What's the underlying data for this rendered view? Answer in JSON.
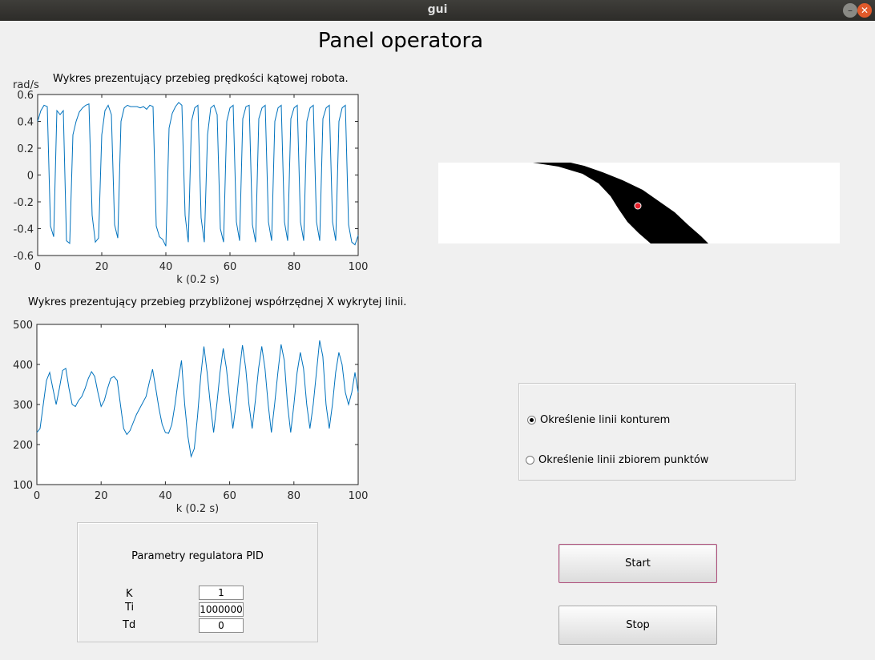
{
  "window": {
    "title": "gui"
  },
  "page": {
    "heading": "Panel operatora"
  },
  "chart_data": [
    {
      "type": "line",
      "title": "Wykres prezentujący przebieg prędkości kątowej robota.",
      "xlabel": "k (0.2 s)",
      "ylabel": "rad/s",
      "xlim": [
        0,
        100
      ],
      "ylim": [
        -0.6,
        0.6
      ],
      "xticks": [
        0,
        20,
        40,
        60,
        80,
        100
      ],
      "yticks": [
        0.6,
        0.4,
        0.2,
        0,
        -0.2,
        -0.4,
        -0.6
      ],
      "ytick_labels": [
        "0.6",
        "0.4",
        "0.2",
        "0",
        "-0.2",
        "-0.4",
        "-0.6"
      ],
      "grid": false,
      "color": "#0072bd",
      "x": [
        0,
        1,
        2,
        3,
        4,
        5,
        6,
        7,
        8,
        9,
        10,
        11,
        12,
        13,
        14,
        15,
        16,
        17,
        18,
        19,
        20,
        21,
        22,
        23,
        24,
        25,
        26,
        27,
        28,
        29,
        30,
        31,
        32,
        33,
        34,
        35,
        36,
        37,
        38,
        39,
        40,
        41,
        42,
        43,
        44,
        45,
        46,
        47,
        48,
        49,
        50,
        51,
        52,
        53,
        54,
        55,
        56,
        57,
        58,
        59,
        60,
        61,
        62,
        63,
        64,
        65,
        66,
        67,
        68,
        69,
        70,
        71,
        72,
        73,
        74,
        75,
        76,
        77,
        78,
        79,
        80,
        81,
        82,
        83,
        84,
        85,
        86,
        87,
        88,
        89,
        90,
        91,
        92,
        93,
        94,
        95,
        96,
        97,
        98,
        99,
        100
      ],
      "y": [
        0.4,
        0.48,
        0.52,
        0.51,
        -0.38,
        -0.46,
        0.48,
        0.45,
        0.48,
        -0.49,
        -0.51,
        0.3,
        0.4,
        0.47,
        0.5,
        0.52,
        0.53,
        -0.3,
        -0.5,
        -0.47,
        0.3,
        0.48,
        0.52,
        0.45,
        -0.37,
        -0.47,
        0.4,
        0.5,
        0.52,
        0.51,
        0.51,
        0.51,
        0.5,
        0.51,
        0.49,
        0.52,
        0.51,
        -0.38,
        -0.46,
        -0.48,
        -0.53,
        0.35,
        0.46,
        0.51,
        0.54,
        0.52,
        -0.3,
        -0.5,
        0.4,
        0.5,
        0.52,
        -0.32,
        -0.5,
        0.3,
        0.5,
        0.52,
        0.45,
        -0.4,
        -0.5,
        0.4,
        0.5,
        0.52,
        -0.35,
        -0.49,
        0.42,
        0.51,
        0.52,
        -0.37,
        -0.5,
        0.42,
        0.5,
        0.52,
        -0.35,
        -0.49,
        0.4,
        0.5,
        0.52,
        -0.35,
        -0.49,
        0.42,
        0.5,
        0.52,
        -0.35,
        -0.49,
        0.4,
        0.5,
        0.52,
        -0.35,
        -0.49,
        0.42,
        0.5,
        0.52,
        -0.35,
        -0.49,
        0.4,
        0.5,
        0.52,
        -0.37,
        -0.5,
        -0.52,
        -0.45
      ]
    },
    {
      "type": "line",
      "title": "Wykres prezentujący przebieg przybliżonej współrzędnej X wykrytej linii.",
      "xlabel": "k (0.2 s)",
      "ylabel": "",
      "xlim": [
        0,
        100
      ],
      "ylim": [
        100,
        500
      ],
      "xticks": [
        0,
        20,
        40,
        60,
        80,
        100
      ],
      "yticks": [
        500,
        400,
        300,
        200,
        100
      ],
      "ytick_labels": [
        "500",
        "400",
        "300",
        "200",
        "100"
      ],
      "grid": false,
      "color": "#0072bd",
      "x": [
        0,
        1,
        2,
        3,
        4,
        5,
        6,
        7,
        8,
        9,
        10,
        11,
        12,
        13,
        14,
        15,
        16,
        17,
        18,
        19,
        20,
        21,
        22,
        23,
        24,
        25,
        26,
        27,
        28,
        29,
        30,
        31,
        32,
        33,
        34,
        35,
        36,
        37,
        38,
        39,
        40,
        41,
        42,
        43,
        44,
        45,
        46,
        47,
        48,
        49,
        50,
        51,
        52,
        53,
        54,
        55,
        56,
        57,
        58,
        59,
        60,
        61,
        62,
        63,
        64,
        65,
        66,
        67,
        68,
        69,
        70,
        71,
        72,
        73,
        74,
        75,
        76,
        77,
        78,
        79,
        80,
        81,
        82,
        83,
        84,
        85,
        86,
        87,
        88,
        89,
        90,
        91,
        92,
        93,
        94,
        95,
        96,
        97,
        98,
        99,
        100
      ],
      "y": [
        230,
        240,
        300,
        360,
        380,
        340,
        300,
        340,
        385,
        390,
        340,
        300,
        295,
        310,
        320,
        340,
        365,
        382,
        370,
        330,
        295,
        310,
        340,
        365,
        370,
        360,
        300,
        240,
        225,
        235,
        255,
        275,
        290,
        305,
        320,
        355,
        388,
        340,
        290,
        250,
        230,
        228,
        250,
        300,
        360,
        410,
        300,
        220,
        170,
        190,
        270,
        370,
        445,
        380,
        300,
        230,
        300,
        380,
        440,
        390,
        310,
        240,
        300,
        380,
        448,
        390,
        300,
        240,
        310,
        390,
        445,
        390,
        300,
        230,
        300,
        380,
        450,
        410,
        300,
        230,
        300,
        380,
        430,
        390,
        300,
        240,
        300,
        380,
        460,
        420,
        300,
        240,
        300,
        380,
        430,
        400,
        330,
        300,
        330,
        380,
        330
      ]
    }
  ],
  "camera": {
    "colors": {
      "background": "#ffffff",
      "line": "#000000",
      "marker": "#e6202b"
    },
    "marker_label": "centroid-marker"
  },
  "radio_group": {
    "options": [
      {
        "label": "Określenie linii konturem",
        "selected": true
      },
      {
        "label": "Określenie linii zbiorem punktów",
        "selected": false
      }
    ]
  },
  "pid": {
    "title": "Parametry regulatora PID",
    "params": [
      {
        "label": "K",
        "value": "1"
      },
      {
        "label": "Ti",
        "value": "1000000"
      },
      {
        "label": "Td",
        "value": "0"
      }
    ]
  },
  "buttons": {
    "start_label": "Start",
    "stop_label": "Stop"
  },
  "colors": {
    "accent_focus": "#b0517d",
    "plot_line": "#0072bd"
  }
}
